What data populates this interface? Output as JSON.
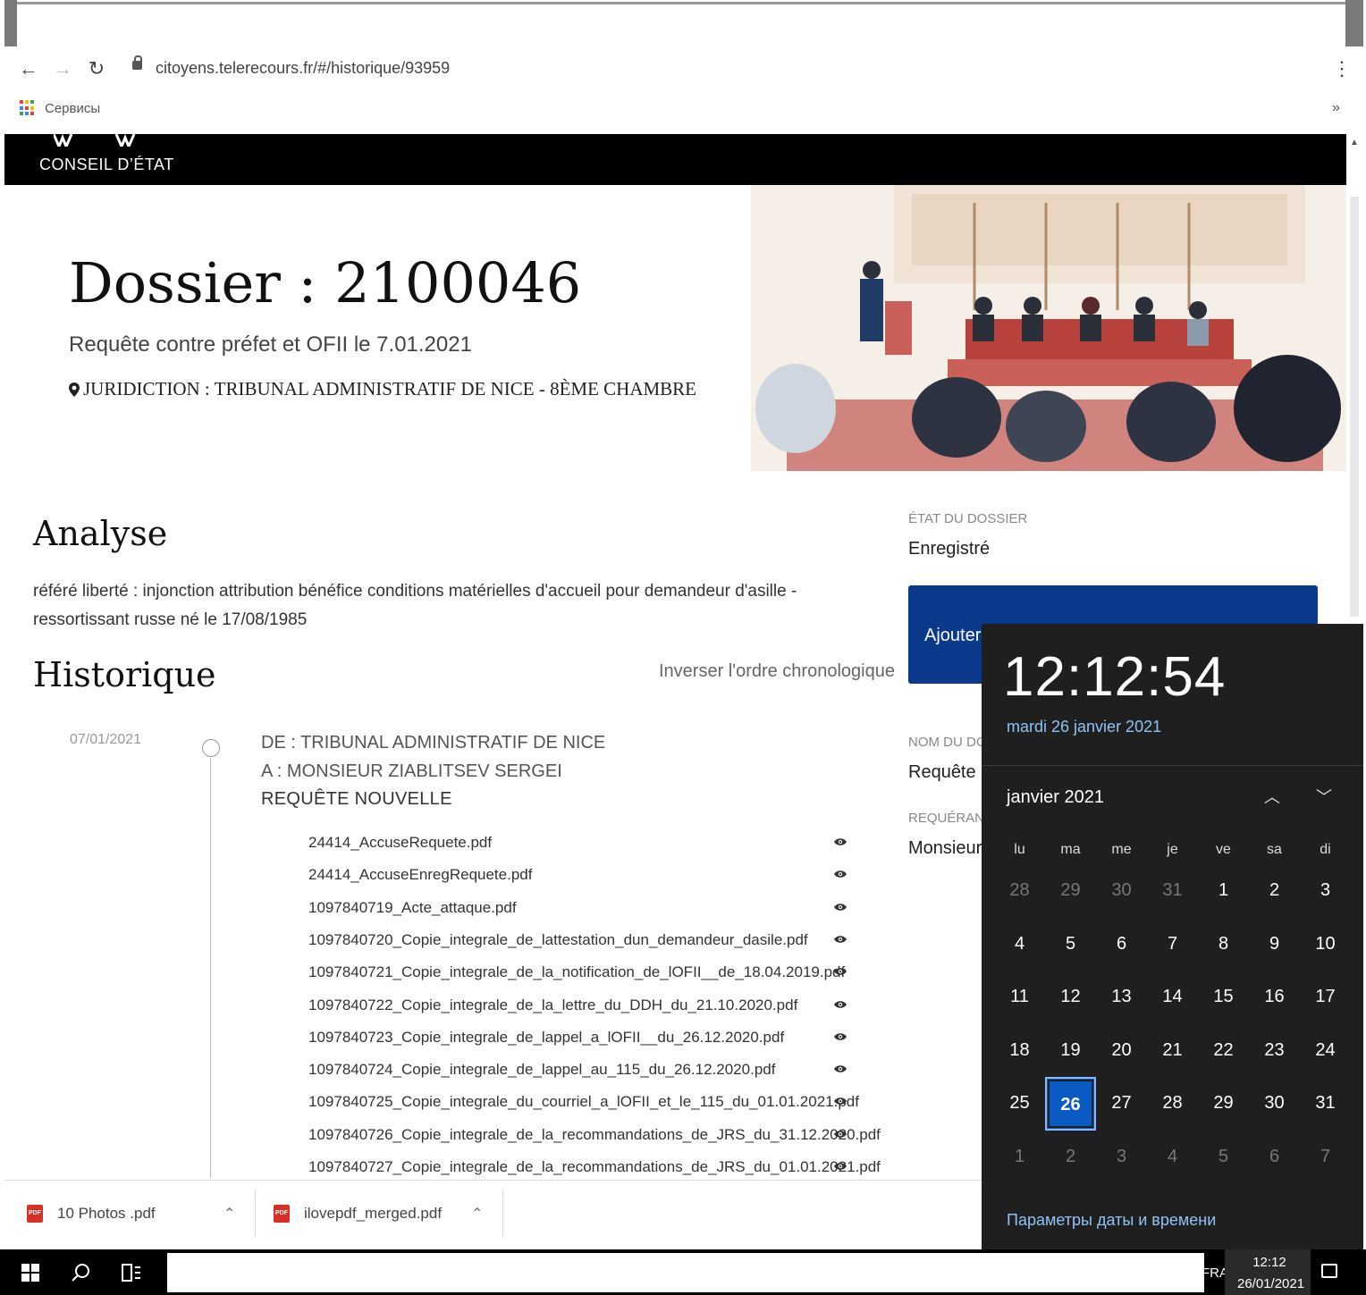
{
  "browser": {
    "url": "citoyens.telerecours.fr/#/historique/93959",
    "bookmark_apps": "Сервисы",
    "more_bookmarks": "»",
    "menu": "⋮"
  },
  "site": {
    "logo_text": "CONSEIL D’ÉTAT"
  },
  "hero": {
    "title": "Dossier : 2100046",
    "subtitle": "Requête contre préfet et OFII le 7.01.2021",
    "juridiction": "JURIDICTION : TRIBUNAL ADMINISTRATIF DE NICE - 8ÈME CHAMBRE"
  },
  "analyse": {
    "title": "Analyse",
    "text": "référé liberté : injonction attribution bénéfice conditions matérielles d'accueil pour demandeur d'asille - ressortissant russe né le 17/08/1985"
  },
  "historique": {
    "title": "Historique",
    "inverser": "Inverser l'ordre chronologique",
    "entry": {
      "date": "07/01/2021",
      "de": "DE : TRIBUNAL ADMINISTRATIF DE NICE",
      "a": "A : MONSIEUR ZIABLITSEV SERGEI",
      "type": "REQUÊTE NOUVELLE",
      "files": [
        "24414_AccuseRequete.pdf",
        "24414_AccuseEnregRequete.pdf",
        "1097840719_Acte_attaque.pdf",
        "1097840720_Copie_integrale_de_lattestation_dun_demandeur_dasile.pdf",
        "1097840721_Copie_integrale_de_la_notification_de_lOFII__de_18.04.2019.pdf",
        "1097840722_Copie_integrale_de_la_lettre_du_DDH_du_21.10.2020.pdf",
        "1097840723_Copie_integrale_de_lappel_a_lOFII__du_26.12.2020.pdf",
        "1097840724_Copie_integrale_de_lappel_au_115_du_26.12.2020.pdf",
        "1097840725_Copie_integrale_du_courriel_a_lOFII_et_le_115_du_01.01.2021.pdf",
        "1097840726_Copie_integrale_de_la_recommandations_de_JRS_du_31.12.2020.pdf",
        "1097840727_Copie_integrale_de_la_recommandations_de_JRS_du_01.01.2021.pdf"
      ]
    }
  },
  "panel": {
    "etat_label": "ÉTAT DU DOSSIER",
    "etat_value": "Enregistré",
    "ajouter_label": "Ajouter",
    "nom_label": "NOM DU DC",
    "nom_value": "Requête c",
    "requerant_label": "REQUÉRANT",
    "requerant_value": "Monsieur"
  },
  "calendar": {
    "time": "12:12:54",
    "date_long": "mardi 26 janvier 2021",
    "month": "janvier 2021",
    "weekdays": [
      "lu",
      "ma",
      "me",
      "je",
      "ve",
      "sa",
      "di"
    ],
    "days": [
      [
        "28",
        true
      ],
      [
        "29",
        true
      ],
      [
        "30",
        true
      ],
      [
        "31",
        true
      ],
      [
        "1",
        false
      ],
      [
        "2",
        false
      ],
      [
        "3",
        false
      ],
      [
        "4",
        false
      ],
      [
        "5",
        false
      ],
      [
        "6",
        false
      ],
      [
        "7",
        false
      ],
      [
        "8",
        false
      ],
      [
        "9",
        false
      ],
      [
        "10",
        false
      ],
      [
        "11",
        false
      ],
      [
        "12",
        false
      ],
      [
        "13",
        false
      ],
      [
        "14",
        false
      ],
      [
        "15",
        false
      ],
      [
        "16",
        false
      ],
      [
        "17",
        false
      ],
      [
        "18",
        false
      ],
      [
        "19",
        false
      ],
      [
        "20",
        false
      ],
      [
        "21",
        false
      ],
      [
        "22",
        false
      ],
      [
        "23",
        false
      ],
      [
        "24",
        false
      ],
      [
        "25",
        false
      ],
      [
        "26",
        false
      ],
      [
        "27",
        false
      ],
      [
        "28",
        false
      ],
      [
        "29",
        false
      ],
      [
        "30",
        false
      ],
      [
        "31",
        false
      ],
      [
        "1",
        true
      ],
      [
        "2",
        true
      ],
      [
        "3",
        true
      ],
      [
        "4",
        true
      ],
      [
        "5",
        true
      ],
      [
        "6",
        true
      ],
      [
        "7",
        true
      ]
    ],
    "today": "26",
    "settings_link": "Параметры даты и времени",
    "accent_color": "#0a5ac4"
  },
  "downloads": {
    "items": [
      "10 Photos .pdf",
      "ilovepdf_merged.pdf"
    ],
    "icon_text": "PDF"
  },
  "taskbar": {
    "lang": "FRA",
    "time": "12:12",
    "date": "26/01/2021"
  },
  "colors": {
    "header_bg": "#000000",
    "button_blue": "#0b3a8c",
    "flyout_bg": "#1f1f1f"
  }
}
